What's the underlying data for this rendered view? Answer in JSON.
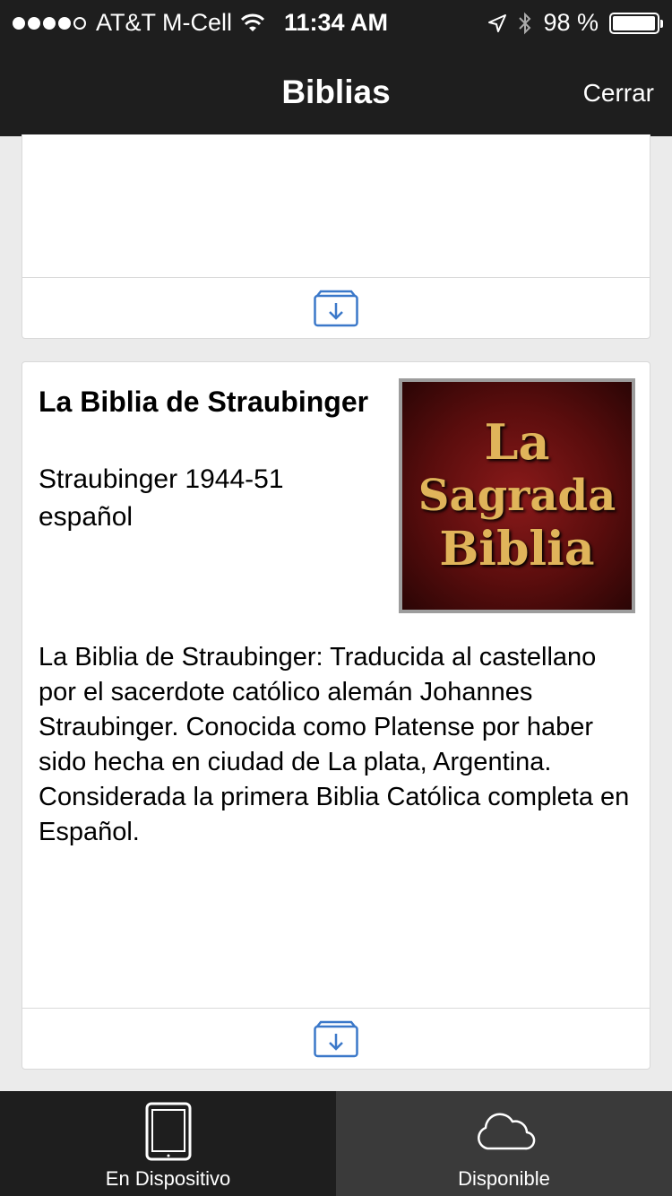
{
  "status_bar": {
    "carrier": "AT&T M-Cell",
    "time": "11:34 AM",
    "battery": "98 %",
    "battery_level": 0.98,
    "signal_bars": 4
  },
  "nav": {
    "title": "Biblias",
    "close_label": "Cerrar"
  },
  "bible": {
    "title": "La Biblia de Straubinger",
    "edition": "Straubinger 1944-51",
    "language": "español",
    "cover_lines": [
      "La",
      "Sagrada",
      "Biblia"
    ],
    "description": "La Biblia de Straubinger: Traducida al castellano por el sacerdote católico alemán Johannes Straubinger. Conocida como Platense por haber sido hecha en ciudad de La plata, Argentina. Considerada la primera Biblia Católica completa en Español."
  },
  "tabs": [
    {
      "label": "En Dispositivo",
      "icon": "tablet-icon",
      "active": false
    },
    {
      "label": "Disponible",
      "icon": "cloud-icon",
      "active": true
    }
  ],
  "colors": {
    "bar_background": "#1e1e1e",
    "active_tab": "#3a3a3a",
    "accent_blue": "#3b78c9",
    "cover_gold": "#e0b45a",
    "cover_red": "#8a1a1a"
  }
}
